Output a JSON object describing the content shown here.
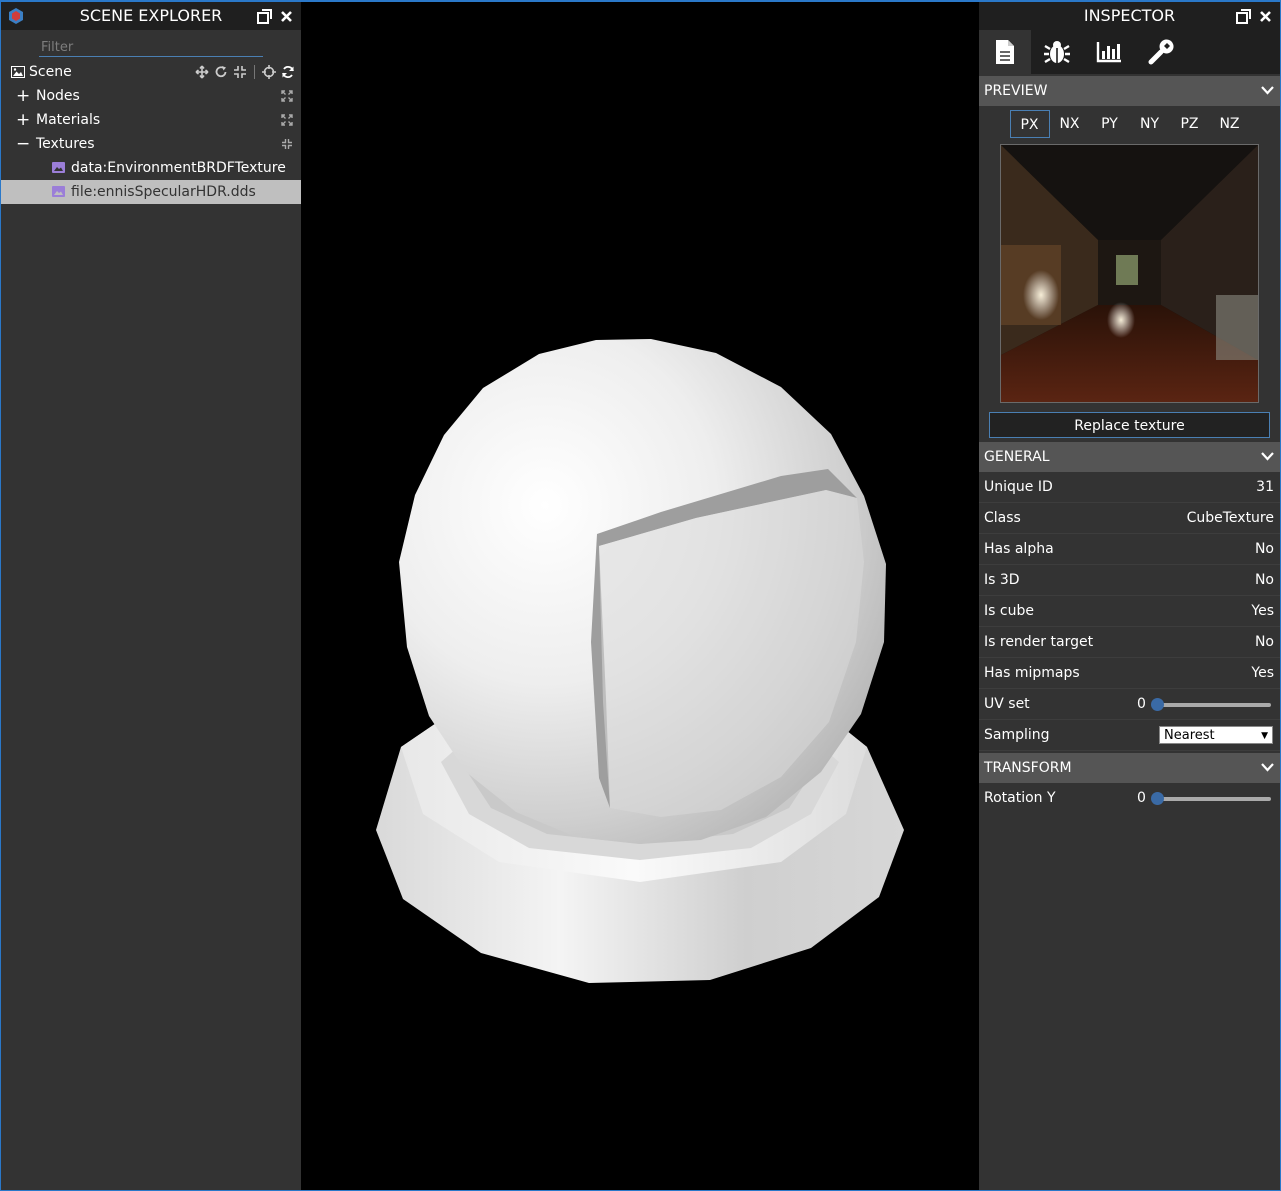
{
  "explorer": {
    "title": "SCENE EXPLORER",
    "filter_placeholder": "Filter",
    "scene_label": "Scene",
    "tree": [
      {
        "label": "Nodes",
        "expander": "+"
      },
      {
        "label": "Materials",
        "expander": "+"
      },
      {
        "label": "Textures",
        "expander": "−"
      }
    ],
    "textures": [
      {
        "label": "data:EnvironmentBRDFTexture",
        "selected": false
      },
      {
        "label": "file:ennisSpecularHDR.dds",
        "selected": true
      }
    ]
  },
  "inspector": {
    "title": "INSPECTOR",
    "tabs": [
      "properties-icon",
      "debug-icon",
      "statistics-icon",
      "tools-icon"
    ],
    "preview": {
      "header": "PREVIEW",
      "faces": [
        "PX",
        "NX",
        "PY",
        "NY",
        "PZ",
        "NZ"
      ],
      "active_face": "PX",
      "replace_label": "Replace texture"
    },
    "general": {
      "header": "GENERAL",
      "props": [
        {
          "label": "Unique ID",
          "value": "31"
        },
        {
          "label": "Class",
          "value": "CubeTexture"
        },
        {
          "label": "Has alpha",
          "value": "No"
        },
        {
          "label": "Is 3D",
          "value": "No"
        },
        {
          "label": "Is cube",
          "value": "Yes"
        },
        {
          "label": "Is render target",
          "value": "No"
        },
        {
          "label": "Has mipmaps",
          "value": "Yes"
        }
      ],
      "uv_set": {
        "label": "UV set",
        "value": "0"
      },
      "sampling": {
        "label": "Sampling",
        "value": "Nearest"
      }
    },
    "transform": {
      "header": "TRANSFORM",
      "rotation_y": {
        "label": "Rotation Y",
        "value": "0"
      }
    }
  }
}
